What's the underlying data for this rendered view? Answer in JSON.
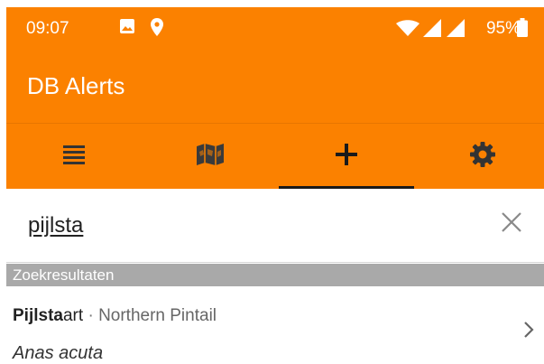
{
  "status": {
    "time": "09:07",
    "battery": "95%"
  },
  "app": {
    "title": "DB Alerts"
  },
  "tabs": [
    {
      "icon": "list-icon"
    },
    {
      "icon": "map-icon"
    },
    {
      "icon": "plus-icon"
    },
    {
      "icon": "gear-icon"
    }
  ],
  "search": {
    "query": "pijlsta"
  },
  "results": {
    "header": "Zoekresultaten",
    "items": [
      {
        "name_match": "Pijlsta",
        "name_rest": "art",
        "separator": " · ",
        "english": "Northern Pintail",
        "scientific": "Anas acuta"
      }
    ]
  },
  "colors": {
    "accent": "#fb8100",
    "section": "#a9a9a9"
  }
}
